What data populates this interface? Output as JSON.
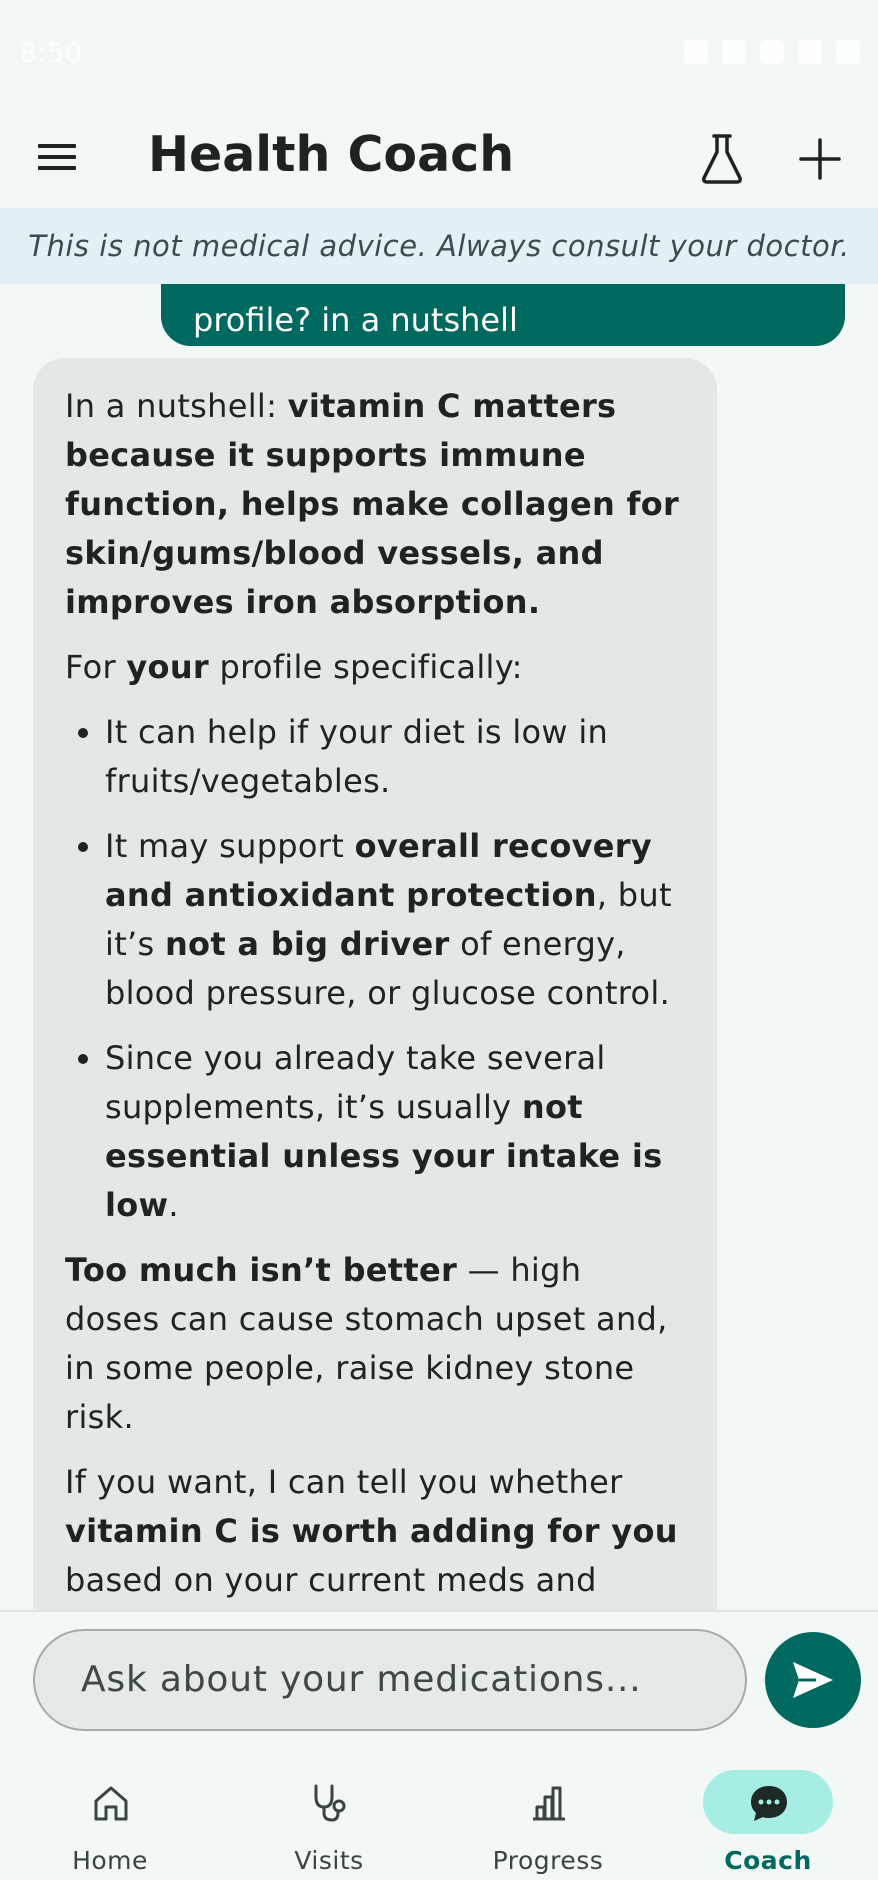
{
  "status_bar": {
    "time": "8:50"
  },
  "app_bar": {
    "title": "Health Coach",
    "icons": [
      "menu-icon",
      "flask-icon",
      "plus-icon"
    ]
  },
  "disclaimer": "This is not medical advice. Always consult your doctor.",
  "chat": {
    "user_message_visible": "profile? in a nutshell",
    "bot_message": {
      "p1_lead": "In a nutshell: ",
      "p1_bold": "vitamin C matters because it supports immune function, helps make collagen for skin/gums/blood vessels, and improves iron absorption.",
      "p2_a": "For ",
      "p2_bold": "your",
      "p2_b": " profile specifically:",
      "b1": "It can help if your diet is low in fruits/vegetables.",
      "b2_a": "It may support ",
      "b2_bold1": "overall recovery and antioxidant protection",
      "b2_b": ", but it’s ",
      "b2_bold2": "not a big driver",
      "b2_c": " of energy, blood pressure, or glucose control.",
      "b3_a": "Since you already take several supplements, it’s usually ",
      "b3_bold": "not essential unless your intake is low",
      "b3_b": ".",
      "p3_bold": "Too much isn’t better",
      "p3_rest": " — high doses can cause stomach upset and, in some people, raise kidney stone risk.",
      "p4_a": "If you want, I can tell you whether ",
      "p4_bold": "vitamin C is worth adding for you",
      "p4_b": " based on your current meds and goals."
    }
  },
  "composer": {
    "placeholder": "Ask about your medications...",
    "send_icon": "send-icon"
  },
  "bottom_nav": {
    "active": "Coach",
    "items": [
      {
        "label": "Home",
        "icon": "home-icon"
      },
      {
        "label": "Visits",
        "icon": "stethoscope-icon"
      },
      {
        "label": "Progress",
        "icon": "bar-chart-icon"
      },
      {
        "label": "Coach",
        "icon": "chat-bubble-icon"
      }
    ]
  },
  "colors": {
    "primary": "#00695f",
    "background": "#f1f8f6",
    "bot_bubble": "#e2e8e6",
    "disclaimer_bg": "#e3f0f5",
    "nav_active_pill": "#a6eee3"
  }
}
